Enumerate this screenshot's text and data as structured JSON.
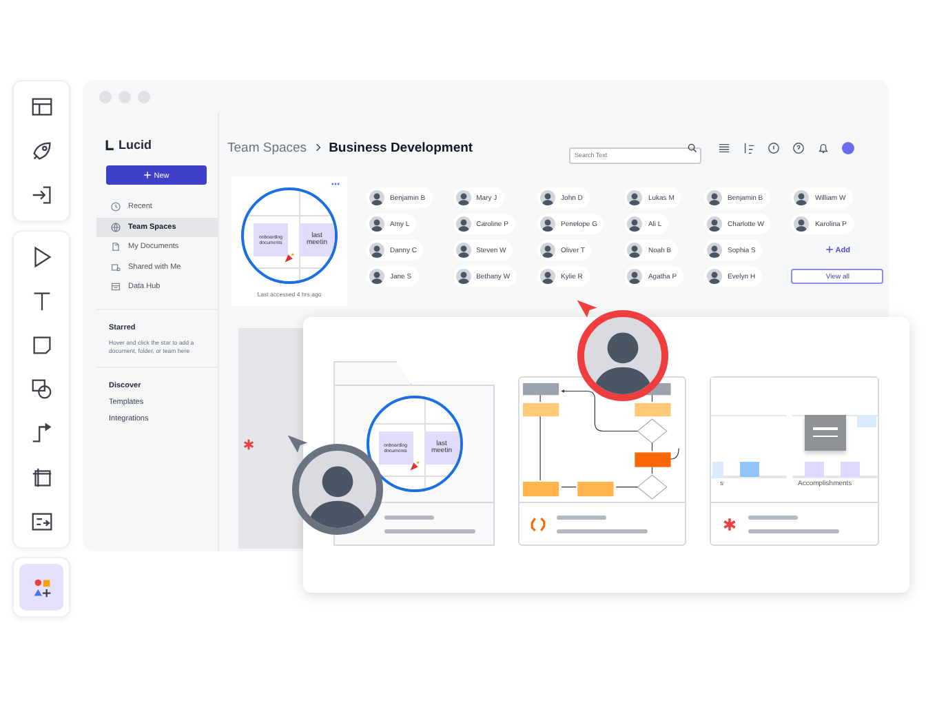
{
  "toolbar": {
    "groups": [
      {
        "tools": [
          {
            "kind": "layout",
            "selected": false
          },
          {
            "kind": "rocket",
            "selected": false
          },
          {
            "kind": "import",
            "selected": false
          }
        ]
      },
      {
        "tools": [
          {
            "kind": "pointer",
            "selected": false
          },
          {
            "kind": "text",
            "selected": false
          },
          {
            "kind": "sticky",
            "selected": false
          },
          {
            "kind": "shapes",
            "selected": false
          },
          {
            "kind": "connector",
            "selected": false
          },
          {
            "kind": "frame",
            "selected": false
          },
          {
            "kind": "data",
            "selected": false
          }
        ]
      },
      {
        "tools": [
          {
            "kind": "library",
            "selected": true
          }
        ]
      }
    ]
  },
  "sidebar": {
    "logo": "Lucid",
    "new_button": "New",
    "nav": [
      {
        "label": "Recent",
        "selected": false
      },
      {
        "label": "Team Spaces",
        "selected": true
      },
      {
        "label": "My Documents",
        "selected": false
      },
      {
        "label": "Shared with Me",
        "selected": false
      },
      {
        "label": "Data Hub",
        "selected": false
      }
    ],
    "starred": {
      "title": "Starred",
      "hint": "Hover and click the star to add a document, folder, or team here"
    },
    "discover": {
      "title": "Discover",
      "links": [
        "Templates",
        "Integrations"
      ]
    }
  },
  "breadcrumb": [
    "Team Spaces",
    "Business Development"
  ],
  "search": {
    "placeholder": "Search Text"
  },
  "document": {
    "notes": [
      "onboarding documents",
      "last meetin"
    ],
    "caption": "Last accessed 4 hrs ago"
  },
  "members": [
    {
      "name": "Benjamin B"
    },
    {
      "name": "Amy L"
    },
    {
      "name": "Danny C"
    },
    {
      "name": "Jane S"
    },
    {
      "name": "Mary J"
    },
    {
      "name": "Caroline P"
    },
    {
      "name": "Steven W"
    },
    {
      "name": "Bethany W"
    },
    {
      "name": "John D"
    },
    {
      "name": "Penelope G"
    },
    {
      "name": "Oliver T"
    },
    {
      "name": "Kylie R"
    },
    {
      "name": "Lukas M"
    },
    {
      "name": "Ali L"
    },
    {
      "name": "Noah B"
    },
    {
      "name": "Agatha P"
    },
    {
      "name": "Benjamin B"
    },
    {
      "name": "Charlotte W"
    },
    {
      "name": "Sophia S"
    },
    {
      "name": "Evelyn H"
    },
    {
      "name": "William W"
    },
    {
      "name": "Karolina P"
    }
  ],
  "add_button": "Add",
  "view_all_button": "View all",
  "showcase": {
    "folder_notes": [
      "onboarding documents",
      "last meetin"
    ],
    "board_labels": [
      "s",
      "Accomplishments"
    ]
  },
  "collaborators": [
    {
      "color": "#6b7280"
    },
    {
      "color": "#f03e3e"
    }
  ]
}
